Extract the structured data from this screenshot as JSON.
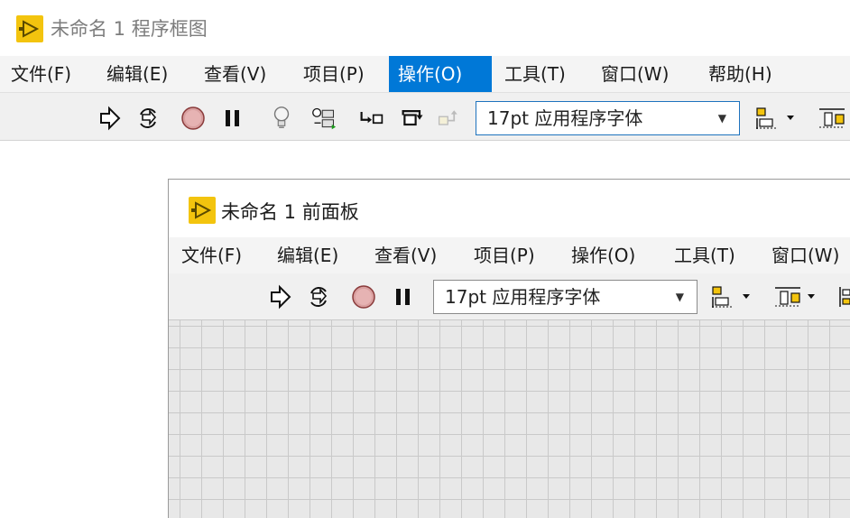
{
  "block_diagram": {
    "title": "未命名 1 程序框图",
    "menu": [
      "文件(F)",
      "编辑(E)",
      "查看(V)",
      "项目(P)",
      "操作(O)",
      "工具(T)",
      "窗口(W)",
      "帮助(H)"
    ],
    "active_menu": "操作(O)",
    "font_select_value": "17pt 应用程序字体",
    "toolbar_icons": [
      "run-arrow-icon",
      "run-continuously-icon",
      "abort-icon",
      "pause-icon",
      "highlight-execution-icon",
      "retain-wire-values-icon",
      "step-into-icon",
      "step-over-icon",
      "step-out-icon",
      "align-objects-icon",
      "distribute-objects-icon"
    ]
  },
  "front_panel": {
    "title": "未命名 1 前面板",
    "menu": [
      "文件(F)",
      "编辑(E)",
      "查看(V)",
      "项目(P)",
      "操作(O)",
      "工具(T)",
      "窗口(W)"
    ],
    "font_select_value": "17pt 应用程序字体",
    "toolbar_icons": [
      "run-arrow-icon",
      "run-continuously-icon",
      "abort-icon",
      "pause-icon",
      "align-objects-icon",
      "distribute-objects-icon",
      "resize-objects-icon"
    ]
  },
  "colors": {
    "menu_active_bg": "#0078d7",
    "labview_logo": "#f3c40e",
    "canvas_grid_bg": "#e8e8e8"
  }
}
